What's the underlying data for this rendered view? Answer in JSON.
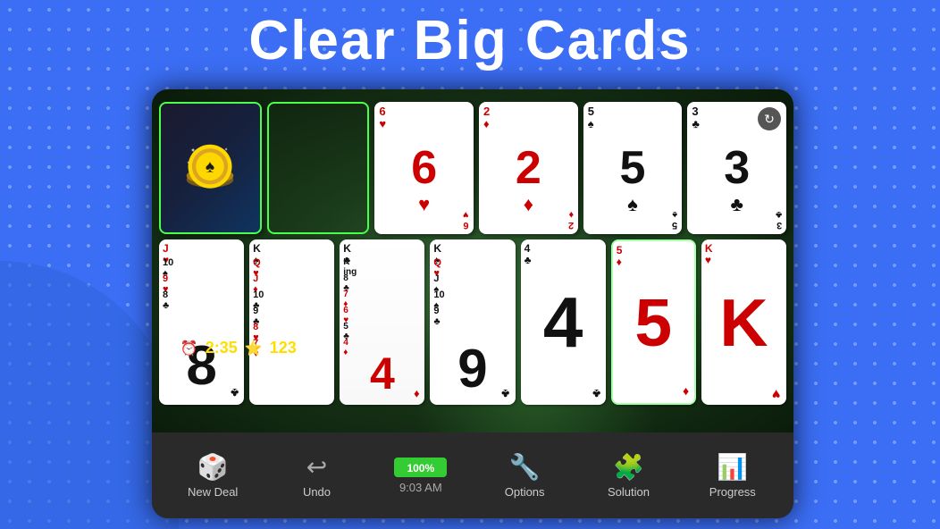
{
  "title": "Clear Big Cards",
  "game": {
    "top_cards": [
      {
        "id": "dark-chip",
        "type": "dark",
        "label": ""
      },
      {
        "id": "empty",
        "type": "empty",
        "label": ""
      },
      {
        "id": "6hearts",
        "rank": "6",
        "suit": "♥",
        "color": "red",
        "corner_bottom": "6♥"
      },
      {
        "id": "2diamonds",
        "rank": "2",
        "suit": "♦",
        "color": "red",
        "corner_bottom": "2♦"
      },
      {
        "id": "5spades",
        "rank": "5",
        "suit": "♠",
        "color": "black",
        "corner_bottom": "5♠"
      },
      {
        "id": "3clubs",
        "rank": "3",
        "suit": "♣",
        "color": "black",
        "corner_bottom": "3♣"
      }
    ],
    "status": {
      "timer_icon": "⏰",
      "timer": "2:35",
      "star_icon": "⭐",
      "score": "123"
    }
  },
  "toolbar": {
    "items": [
      {
        "id": "new-deal",
        "label": "New Deal",
        "icon": "🎲"
      },
      {
        "id": "undo",
        "label": "Undo",
        "icon": "↩"
      },
      {
        "id": "time",
        "label": "9:03 AM",
        "icon": "100%",
        "is_center": true
      },
      {
        "id": "options",
        "label": "Options",
        "icon": "🔧"
      },
      {
        "id": "solution",
        "label": "Solution",
        "icon": "🧩"
      },
      {
        "id": "progress",
        "label": "Progress",
        "icon": "📊"
      }
    ]
  }
}
